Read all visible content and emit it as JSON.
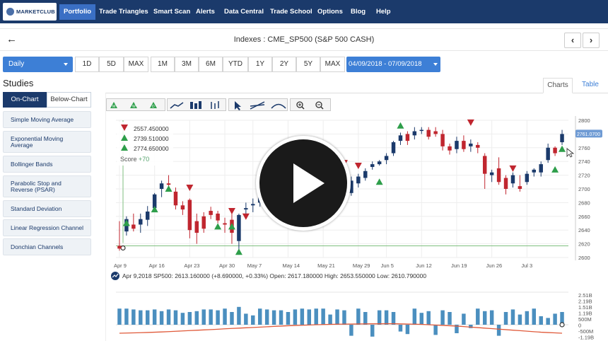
{
  "nav": {
    "logo_text": "MARKETCLUB",
    "items": [
      {
        "label": "Portfolio",
        "active": true
      },
      {
        "label": "Trade Triangles",
        "active": false
      },
      {
        "label": "Smart Scan",
        "active": false
      },
      {
        "label": "Alerts",
        "active": false
      },
      {
        "label": "Data Central",
        "active": false
      },
      {
        "label": "Trade School",
        "active": false
      },
      {
        "label": "Options",
        "active": false
      },
      {
        "label": "Blog",
        "active": false
      },
      {
        "label": "Help",
        "active": false
      }
    ]
  },
  "header": {
    "title": "Indexes : CME_SP500 (S&P 500 CASH)",
    "prev_label": "‹",
    "next_label": "›"
  },
  "period": {
    "selected": "Daily",
    "quick_ranges_a": [
      "1D",
      "5D",
      "MAX"
    ],
    "quick_ranges_b": [
      "1M",
      "3M",
      "6M",
      "YTD",
      "1Y",
      "2Y",
      "5Y",
      "MAX"
    ],
    "date_range": "04/09/2018 - 07/09/2018"
  },
  "studies": {
    "title": "Studies",
    "tabs": [
      "On-Chart",
      "Below-Chart"
    ],
    "items": [
      "Simple Moving Average",
      "Exponential Moving Average",
      "Bollinger Bands",
      "Parabolic Stop and Reverse (PSAR)",
      "Standard Deviation",
      "Linear Regression Channel",
      "Donchian Channels"
    ]
  },
  "view_tabs": {
    "charts": "Charts",
    "table": "Table"
  },
  "info": {
    "levels": [
      {
        "dir": "down",
        "value": "2557.450000"
      },
      {
        "dir": "up",
        "value": "2739.510000"
      },
      {
        "dir": "up",
        "value": "2774.650000"
      }
    ],
    "score_label": "Score",
    "score_value": "+70"
  },
  "ohlc_text": "Apr 9,2018 SP500: 2613.160000 (+8.690000, +0.33%) Open: 2617.180000 High: 2653.550000 Low: 2610.790000",
  "colors": {
    "nav_bg": "#1b3a6b",
    "accent": "#3d7fd6",
    "bull": "#1b3a6b",
    "bear": "#c0262f",
    "up_triangle": "#2e9e4a",
    "down_triangle": "#c0262f",
    "volume_bar": "#4b8fbf",
    "volume_avg": "#e05a3a",
    "price_tag": "#6f9bd4"
  },
  "chart_data": {
    "type": "candlestick",
    "x_labels": [
      "Apr 9",
      "Apr 16",
      "Apr 23",
      "Apr 30",
      "May 7",
      "May 14",
      "May 21",
      "May 29",
      "Jun 5",
      "Jun 12",
      "Jun 19",
      "Jun 26",
      "Jul 3"
    ],
    "y_ticks": [
      2600,
      2620,
      2640,
      2660,
      2680,
      2700,
      2720,
      2740,
      2760,
      2780,
      2800
    ],
    "ylim": [
      2600,
      2800
    ],
    "last_price_tag": "2761.0700",
    "candles": [
      {
        "o": 2617,
        "h": 2653,
        "l": 2610,
        "c": 2613
      },
      {
        "o": 2638,
        "h": 2660,
        "l": 2632,
        "c": 2656
      },
      {
        "o": 2648,
        "h": 2664,
        "l": 2638,
        "c": 2642
      },
      {
        "o": 2648,
        "h": 2664,
        "l": 2636,
        "c": 2656
      },
      {
        "o": 2655,
        "h": 2675,
        "l": 2646,
        "c": 2667
      },
      {
        "o": 2672,
        "h": 2694,
        "l": 2668,
        "c": 2692
      },
      {
        "o": 2700,
        "h": 2712,
        "l": 2688,
        "c": 2708
      },
      {
        "o": 2708,
        "h": 2720,
        "l": 2700,
        "c": 2706
      },
      {
        "o": 2696,
        "h": 2702,
        "l": 2670,
        "c": 2676
      },
      {
        "o": 2676,
        "h": 2682,
        "l": 2662,
        "c": 2670
      },
      {
        "o": 2684,
        "h": 2686,
        "l": 2628,
        "c": 2640
      },
      {
        "o": 2653,
        "h": 2664,
        "l": 2620,
        "c": 2636
      },
      {
        "o": 2660,
        "h": 2666,
        "l": 2636,
        "c": 2642
      },
      {
        "o": 2668,
        "h": 2674,
        "l": 2656,
        "c": 2662
      },
      {
        "o": 2664,
        "h": 2668,
        "l": 2650,
        "c": 2654
      },
      {
        "o": 2650,
        "h": 2658,
        "l": 2636,
        "c": 2648
      },
      {
        "o": 2655,
        "h": 2665,
        "l": 2620,
        "c": 2636
      },
      {
        "o": 2624,
        "h": 2664,
        "l": 2604,
        "c": 2662
      },
      {
        "o": 2670,
        "h": 2680,
        "l": 2662,
        "c": 2672
      },
      {
        "o": 2676,
        "h": 2686,
        "l": 2666,
        "c": 2678
      },
      {
        "o": 2680,
        "h": 2700,
        "l": 2674,
        "c": 2696
      },
      {
        "o": 2698,
        "h": 2722,
        "l": 2692,
        "c": 2718
      },
      {
        "o": 2720,
        "h": 2740,
        "l": 2716,
        "c": 2738
      },
      {
        "o": 2736,
        "h": 2740,
        "l": 2716,
        "c": 2720
      },
      {
        "o": 2716,
        "h": 2724,
        "l": 2706,
        "c": 2712
      },
      {
        "o": 2712,
        "h": 2726,
        "l": 2706,
        "c": 2722
      },
      {
        "o": 2724,
        "h": 2736,
        "l": 2718,
        "c": 2732
      },
      {
        "o": 2732,
        "h": 2742,
        "l": 2722,
        "c": 2728
      },
      {
        "o": 2730,
        "h": 2738,
        "l": 2724,
        "c": 2734
      },
      {
        "o": 2736,
        "h": 2740,
        "l": 2722,
        "c": 2726
      },
      {
        "o": 2726,
        "h": 2730,
        "l": 2712,
        "c": 2718
      },
      {
        "o": 2716,
        "h": 2720,
        "l": 2700,
        "c": 2706
      },
      {
        "o": 2704,
        "h": 2712,
        "l": 2680,
        "c": 2688
      },
      {
        "o": 2694,
        "h": 2718,
        "l": 2690,
        "c": 2712
      },
      {
        "o": 2708,
        "h": 2722,
        "l": 2702,
        "c": 2718
      },
      {
        "o": 2716,
        "h": 2730,
        "l": 2712,
        "c": 2726
      },
      {
        "o": 2732,
        "h": 2740,
        "l": 2728,
        "c": 2736
      },
      {
        "o": 2736,
        "h": 2742,
        "l": 2734,
        "c": 2740
      },
      {
        "o": 2742,
        "h": 2752,
        "l": 2736,
        "c": 2748
      },
      {
        "o": 2752,
        "h": 2770,
        "l": 2748,
        "c": 2768
      },
      {
        "o": 2770,
        "h": 2782,
        "l": 2764,
        "c": 2778
      },
      {
        "o": 2780,
        "h": 2784,
        "l": 2764,
        "c": 2770
      },
      {
        "o": 2778,
        "h": 2790,
        "l": 2772,
        "c": 2784
      },
      {
        "o": 2785,
        "h": 2790,
        "l": 2780,
        "c": 2786
      },
      {
        "o": 2786,
        "h": 2790,
        "l": 2772,
        "c": 2776
      },
      {
        "o": 2784,
        "h": 2790,
        "l": 2776,
        "c": 2780
      },
      {
        "o": 2780,
        "h": 2786,
        "l": 2756,
        "c": 2762
      },
      {
        "o": 2762,
        "h": 2766,
        "l": 2750,
        "c": 2756
      },
      {
        "o": 2758,
        "h": 2776,
        "l": 2752,
        "c": 2770
      },
      {
        "o": 2770,
        "h": 2778,
        "l": 2754,
        "c": 2758
      },
      {
        "o": 2762,
        "h": 2772,
        "l": 2754,
        "c": 2766
      },
      {
        "o": 2764,
        "h": 2768,
        "l": 2752,
        "c": 2760
      },
      {
        "o": 2748,
        "h": 2752,
        "l": 2700,
        "c": 2722
      },
      {
        "o": 2720,
        "h": 2728,
        "l": 2710,
        "c": 2724
      },
      {
        "o": 2730,
        "h": 2746,
        "l": 2706,
        "c": 2710
      },
      {
        "o": 2716,
        "h": 2720,
        "l": 2692,
        "c": 2700
      },
      {
        "o": 2708,
        "h": 2724,
        "l": 2702,
        "c": 2720
      },
      {
        "o": 2704,
        "h": 2720,
        "l": 2696,
        "c": 2700
      },
      {
        "o": 2710,
        "h": 2726,
        "l": 2706,
        "c": 2722
      },
      {
        "o": 2724,
        "h": 2730,
        "l": 2718,
        "c": 2728
      },
      {
        "o": 2724,
        "h": 2740,
        "l": 2718,
        "c": 2736
      },
      {
        "o": 2742,
        "h": 2766,
        "l": 2738,
        "c": 2760
      },
      {
        "o": 2760,
        "h": 2762,
        "l": 2748,
        "c": 2752
      },
      {
        "o": 2768,
        "h": 2786,
        "l": 2764,
        "c": 2780
      }
    ],
    "signals": [
      {
        "i": 1,
        "dir": "up",
        "price": 2650
      },
      {
        "i": 5,
        "dir": "up",
        "price": 2670
      },
      {
        "i": 7,
        "dir": "up",
        "price": 2700
      },
      {
        "i": 10,
        "dir": "down",
        "price": 2702
      },
      {
        "i": 14,
        "dir": "up",
        "price": 2645
      },
      {
        "i": 16,
        "dir": "up",
        "price": 2645
      },
      {
        "i": 16,
        "dir": "down",
        "price": 2668
      },
      {
        "i": 17,
        "dir": "up",
        "price": 2608
      },
      {
        "i": 18,
        "dir": "down",
        "price": 2660
      },
      {
        "i": 20,
        "dir": "up",
        "price": 2702
      },
      {
        "i": 28,
        "dir": "up",
        "price": 2722
      },
      {
        "i": 32,
        "dir": "down",
        "price": 2738
      },
      {
        "i": 34,
        "dir": "down",
        "price": 2734
      },
      {
        "i": 37,
        "dir": "up",
        "price": 2710
      },
      {
        "i": 40,
        "dir": "up",
        "price": 2792
      },
      {
        "i": 50,
        "dir": "down",
        "price": 2797
      },
      {
        "i": 56,
        "dir": "down",
        "price": 2730
      },
      {
        "i": 62,
        "dir": "up",
        "price": 2728
      },
      {
        "i": 63,
        "dir": "up",
        "price": 2758
      }
    ],
    "baseline": 2617,
    "volume": {
      "y_ticks": [
        "2.51B",
        "2.19B",
        "1.51B",
        "1.19B",
        "500M",
        "0",
        "-500M",
        "-1.19B"
      ],
      "values": [
        1.9,
        1.9,
        1.8,
        1.7,
        1.7,
        1.8,
        1.6,
        1.8,
        1.7,
        1.4,
        1.5,
        1.6,
        1.8,
        1.8,
        1.7,
        1.9,
        1.5,
        2.1,
        1.3,
        1.1,
        1.9,
        1.8,
        1.7,
        1.7,
        1.5,
        1.8,
        1.9,
        1.8,
        1.9,
        1.9,
        1.2,
        1.8,
        1.7,
        -1.3,
        1.9,
        1.5,
        -1.4,
        1.7,
        1.7,
        1.5,
        -0.8,
        -1.1,
        1.9,
        1.4,
        1.6,
        -1.2,
        1.7,
        1.5,
        -1.0,
        1.3,
        -0.4,
        1.9,
        1.6,
        1.7,
        -1.3,
        1.5,
        1.8,
        1.2,
        1.6,
        1.9,
        1.0,
        0.8,
        1.3,
        1.5
      ],
      "avg": [
        0.0,
        0.02,
        0.04,
        0.06,
        0.09,
        0.12,
        0.15,
        0.19,
        0.23,
        0.27,
        0.31,
        0.35,
        0.39,
        0.43,
        0.47,
        0.52,
        0.56,
        0.6,
        0.64,
        0.68,
        0.72,
        0.76,
        0.8,
        0.84,
        0.88,
        0.91,
        0.94,
        0.97,
        1.0,
        1.02,
        1.04,
        1.06,
        1.07,
        1.08,
        1.09,
        1.1,
        1.11,
        1.11,
        1.12,
        1.12,
        1.1,
        1.08,
        1.06,
        1.04,
        1.0,
        0.96,
        0.92,
        0.88,
        0.84,
        0.78,
        0.72,
        0.66,
        0.6,
        0.54,
        0.48,
        0.42,
        0.36,
        0.3,
        0.24,
        0.18,
        0.12,
        0.08,
        0.04,
        0.0
      ]
    }
  }
}
